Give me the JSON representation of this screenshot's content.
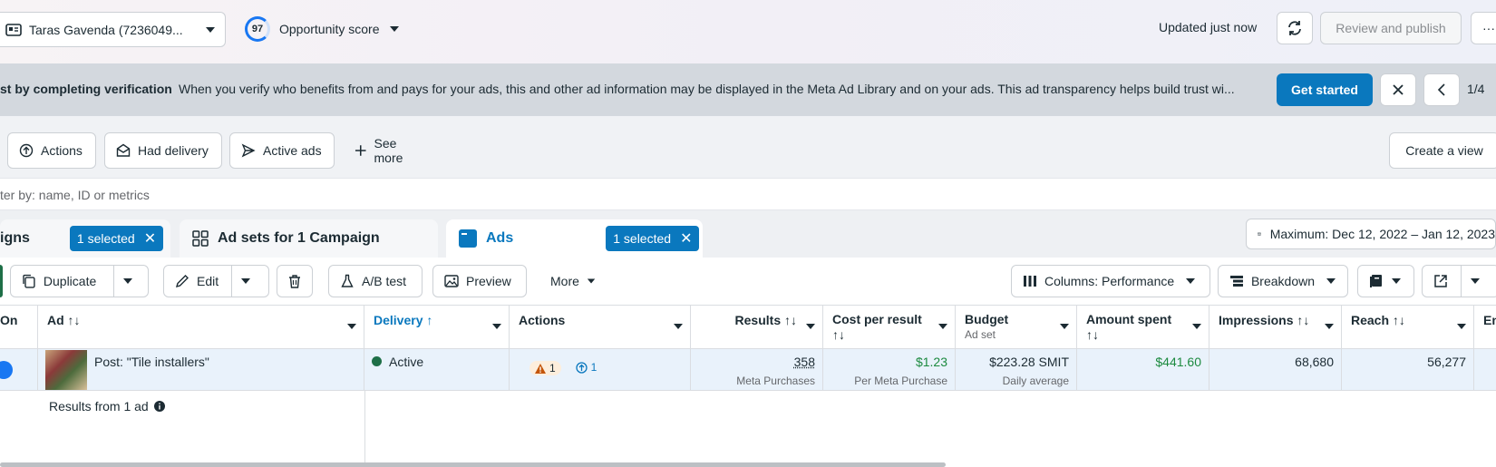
{
  "header": {
    "account_name": "Taras Gavenda (7236049...",
    "opportunity_score": "97",
    "opportunity_label": "Opportunity score",
    "updated": "Updated just now",
    "review_publish": "Review and publish",
    "more": "···"
  },
  "banner": {
    "title": "st by completing verification",
    "text": "When you verify who benefits from and pays for your ads, this and other ad information may be displayed in the Meta Ad Library and on your ads. This ad transparency helps build trust wi...",
    "cta": "Get started",
    "pager": "1/4"
  },
  "views": {
    "actions": "Actions",
    "had_delivery": "Had delivery",
    "active_ads": "Active ads",
    "see_more": "See more",
    "create_view": "Create a view"
  },
  "filter": {
    "placeholder": "ter by: name, ID or metrics"
  },
  "tabs": {
    "campaigns": "igns",
    "campaigns_selected": "1 selected",
    "adsets": "Ad sets for 1 Campaign",
    "ads": "Ads",
    "ads_selected": "1 selected",
    "date_range": "Maximum: Dec 12, 2022 – Jan 12, 2023"
  },
  "toolbar": {
    "duplicate": "Duplicate",
    "edit": "Edit",
    "ab_test": "A/B test",
    "preview": "Preview",
    "more": "More",
    "columns": "Columns: Performance",
    "breakdown": "Breakdown"
  },
  "table": {
    "headers": {
      "on": "On",
      "ad": "Ad ↑↓",
      "delivery": "Delivery ↑",
      "actions": "Actions",
      "results": "Results ↑↓",
      "cost": "Cost per result",
      "cost_sort": "↑↓",
      "budget": "Budget",
      "budget_sub": "Ad set",
      "amount": "Amount spent",
      "amount_sort": "↑↓",
      "impressions": "Impressions ↑↓",
      "reach": "Reach ↑↓",
      "next": "En"
    },
    "row": {
      "ad_name": "Post: \"Tile installers\"",
      "delivery": "Active",
      "warn_count": "1",
      "info_count": "1",
      "results": "358",
      "results_sub": "Meta Purchases",
      "cost": "$1.23",
      "cost_sub": "Per Meta Purchase",
      "budget": "$223.28 SMIT",
      "budget_sub": "Daily average",
      "amount": "$441.60",
      "impressions": "68,680",
      "reach": "56,277"
    },
    "summary": "Results from 1 ad"
  },
  "colors": {
    "accent": "#0a78be",
    "active": "#1e6f47",
    "green": "#1c8a3f"
  }
}
